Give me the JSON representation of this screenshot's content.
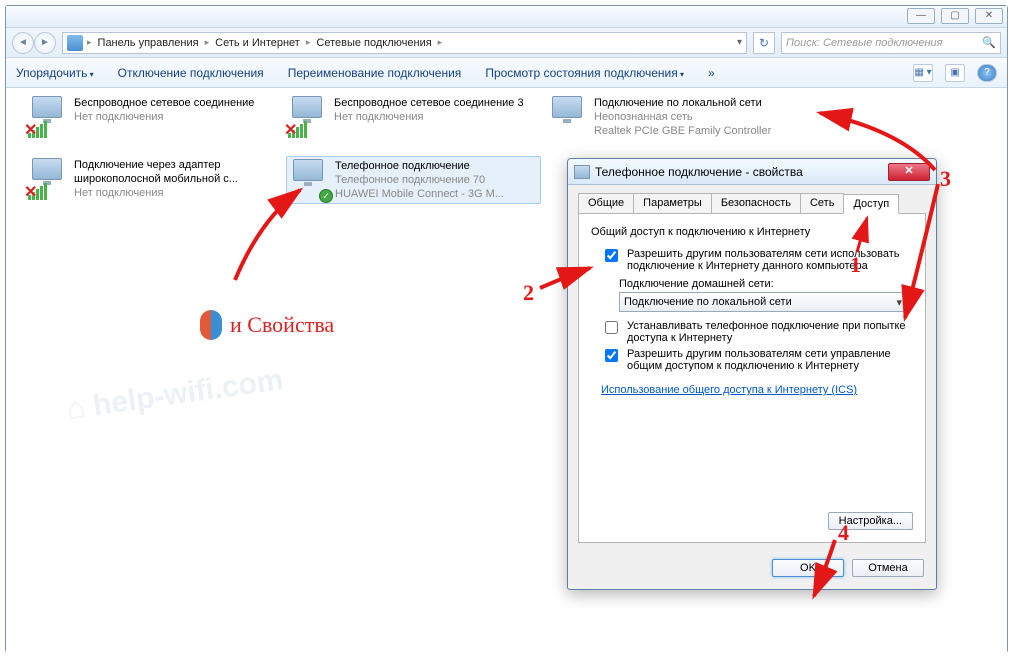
{
  "window_buttons": {
    "min": "—",
    "max": "▢",
    "close": "✕"
  },
  "breadcrumb": {
    "a": "Панель управления",
    "b": "Сеть и Интернет",
    "c": "Сетевые подключения"
  },
  "search_placeholder": "Поиск: Сетевые подключения",
  "toolbar": {
    "organize": "Упорядочить",
    "disable": "Отключение подключения",
    "rename": "Переименование подключения",
    "status": "Просмотр состояния подключения"
  },
  "connections": [
    {
      "t1": "Беспроводное сетевое соединение",
      "t2": "Нет подключения",
      "t3": ""
    },
    {
      "t1": "Беспроводное сетевое соединение 3",
      "t2": "Нет подключения",
      "t3": ""
    },
    {
      "t1": "Подключение по локальной сети",
      "t2": "Неопознанная сеть",
      "t3": "Realtek PCIe GBE Family Controller"
    },
    {
      "t1": "Подключение через адаптер широкополосной мобильной с...",
      "t2": "Нет подключения",
      "t3": ""
    },
    {
      "t1": "Телефонное подключение",
      "t2": "Телефонное подключение 70",
      "t3": "HUAWEI Mobile Connect - 3G M..."
    }
  ],
  "dialog": {
    "title": "Телефонное подключение - свойства",
    "tabs": [
      "Общие",
      "Параметры",
      "Безопасность",
      "Сеть",
      "Доступ"
    ],
    "section": "Общий доступ к подключению к Интернету",
    "opt1": "Разрешить другим пользователям сети использовать подключение к Интернету данного компьютера",
    "homenet_label": "Подключение домашней сети:",
    "dropdown": "Подключение по локальной сети",
    "opt2": "Устанавливать телефонное подключение при попытке доступа к Интернету",
    "opt3": "Разрешить другим пользователям сети управление общим доступом к подключению к Интернету",
    "link": "Использование общего доступа к Интернету (ICS)",
    "settings": "Настройка...",
    "ok": "OK",
    "cancel": "Отмена"
  },
  "anno": {
    "text": "и Свойства",
    "n1": "1",
    "n2": "2",
    "n3": "3",
    "n4": "4"
  }
}
